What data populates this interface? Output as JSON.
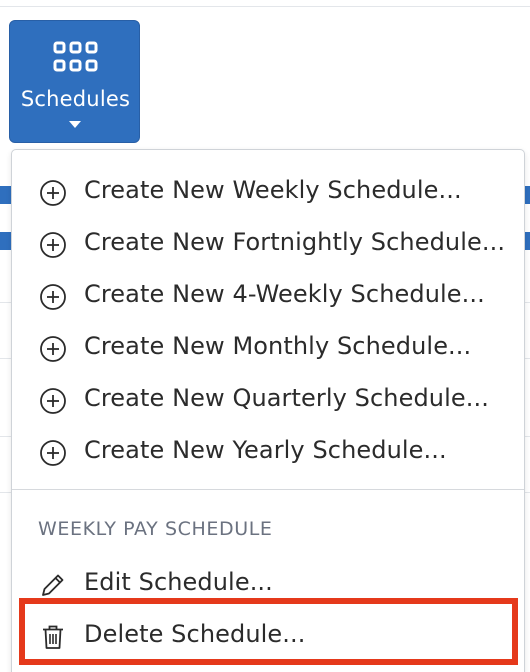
{
  "toolbar": {
    "schedules_button": {
      "label": "Schedules",
      "icon": "grid-icon"
    }
  },
  "menu": {
    "create_items": [
      {
        "label": "Create New Weekly Schedule...",
        "icon": "plus-circle-icon"
      },
      {
        "label": "Create New Fortnightly Schedule...",
        "icon": "plus-circle-icon"
      },
      {
        "label": "Create New 4-Weekly Schedule...",
        "icon": "plus-circle-icon"
      },
      {
        "label": "Create New Monthly Schedule...",
        "icon": "plus-circle-icon"
      },
      {
        "label": "Create New Quarterly Schedule...",
        "icon": "plus-circle-icon"
      },
      {
        "label": "Create New Yearly Schedule...",
        "icon": "plus-circle-icon"
      }
    ],
    "section_heading": "WEEKLY PAY SCHEDULE",
    "edit_item": {
      "label": "Edit Schedule...",
      "icon": "pencil-icon"
    },
    "delete_item": {
      "label": "Delete Schedule...",
      "icon": "trash-icon"
    }
  },
  "colors": {
    "primary": "#2f6fbe",
    "highlight": "#e5391b",
    "text": "#2b2b2b",
    "muted": "#6b7280"
  }
}
